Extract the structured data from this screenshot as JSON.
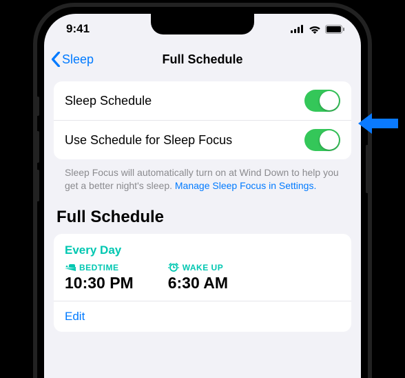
{
  "status": {
    "time": "9:41"
  },
  "nav": {
    "back": "Sleep",
    "title": "Full Schedule"
  },
  "settings": {
    "row1": "Sleep Schedule",
    "row2": "Use Schedule for Sleep Focus",
    "footer_a": "Sleep Focus will automatically turn on at Wind Down to help you get a better night's sleep. ",
    "footer_link": "Manage Sleep Focus in Settings."
  },
  "section": {
    "header": "Full Schedule"
  },
  "schedule": {
    "days": "Every Day",
    "bed_label": "BEDTIME",
    "bed_time": "10:30 PM",
    "wake_label": "WAKE UP",
    "wake_time": "6:30 AM",
    "edit": "Edit"
  }
}
